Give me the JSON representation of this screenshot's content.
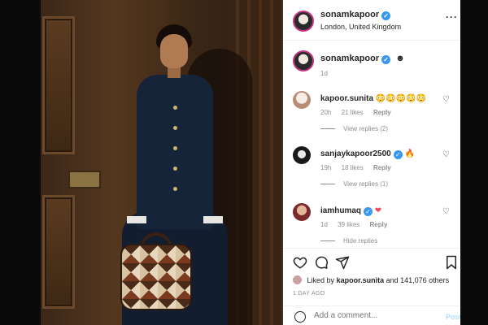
{
  "post": {
    "username": "sonamkapoor",
    "location": "London, United Kingdom",
    "more_icon": "more-options-icon",
    "caption": {
      "username": "sonamkapoor",
      "emoji": "☻",
      "time": "1d"
    }
  },
  "comments": [
    {
      "username": "kapoor.sunita",
      "text": "😳😳😳😳😳",
      "verified": false,
      "time": "20h",
      "likes": "21 likes",
      "reply": "Reply",
      "view_replies": "View replies (2)"
    },
    {
      "username": "sanjaykapoor2500",
      "text": "🔥",
      "verified": true,
      "time": "19h",
      "likes": "18 likes",
      "reply": "Reply",
      "view_replies": "View replies (1)"
    },
    {
      "username": "iamhumaq",
      "text": "❤",
      "verified": true,
      "time": "1d",
      "likes": "39 likes",
      "reply": "Reply",
      "view_replies": "Hide replies"
    }
  ],
  "actions": {
    "liked_prefix": "Liked by",
    "liked_user": "kapoor.sunita",
    "liked_suffix": "and 141,076 others",
    "date": "1 DAY AGO",
    "add_comment_placeholder": "Add a comment...",
    "post_label": "Post"
  },
  "colors": {
    "verified": "#3897f0",
    "link": "#b2dffc",
    "muted": "#8e8e8e",
    "text": "#262626"
  }
}
